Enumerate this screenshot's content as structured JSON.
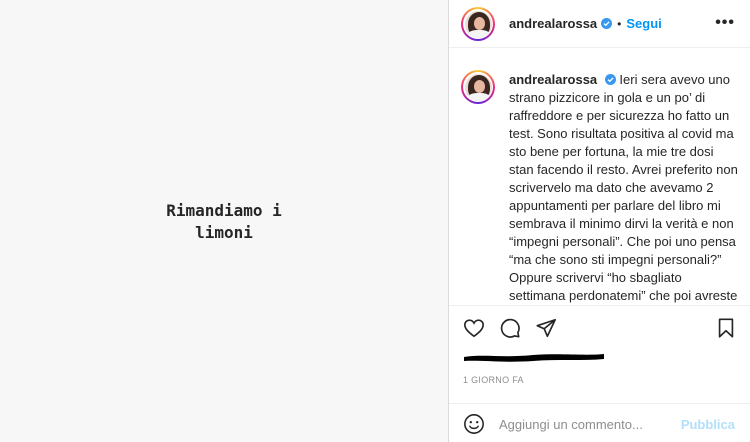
{
  "media": {
    "text": "Rimandiamo i limoni"
  },
  "header": {
    "username": "andrealarossa",
    "separator": "•",
    "follow_label": "Segui",
    "more_label": "•••"
  },
  "caption": {
    "username": "andrealarossa",
    "text": "Ieri sera avevo uno strano pizzicore in gola e un po’ di raffreddore e per sicurezza ho fatto un test. Sono risultata positiva al covid ma sto bene per fortuna, la mie tre dosi stan facendo il resto. Avrei preferito non scrivervelo ma dato che avevamo 2 appuntamenti per parlare del libro mi sembrava il minimo dirvi la verità e non “impegni personali”. Che poi uno pensa “ma che sono sti impegni personali?” Oppure scrivervi “ho sbagliato settimana perdonatemi” che poi avreste pensato che mi sono"
  },
  "actions": {
    "icons": [
      "heart-icon",
      "comment-icon",
      "share-icon",
      "bookmark-icon"
    ]
  },
  "timestamp": "1 GIORNO FA",
  "comment": {
    "placeholder": "Aggiungi un commento...",
    "publish_label": "Pubblica"
  },
  "colors": {
    "accent": "#0095f6",
    "publish_disabled": "#b2dffc",
    "verified": "#3897f0",
    "muted": "#8e8e8e"
  }
}
